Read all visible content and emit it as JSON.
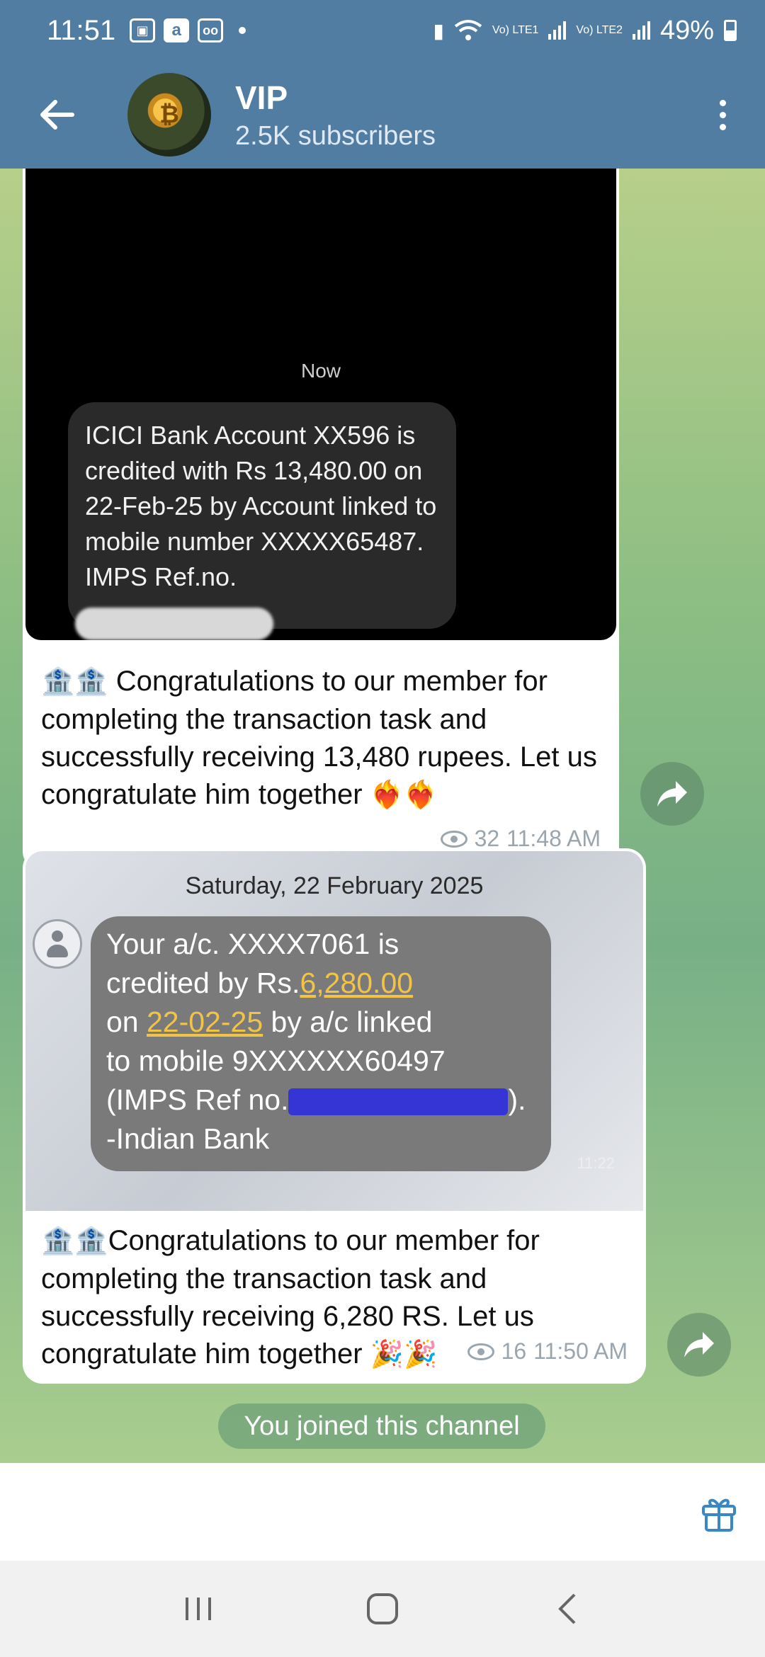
{
  "status_bar": {
    "time": "11:51",
    "battery": "49%",
    "sim1_label": "Vo) LTE1",
    "sim2_label": "Vo) LTE2"
  },
  "header": {
    "title": "VIP",
    "subtitle": "2.5K subscribers"
  },
  "messages": [
    {
      "image": {
        "timestamp_label": "Now",
        "sms_text": "ICICI Bank Account XX596 is credited with Rs 13,480.00 on 22-Feb-25 by Account linked to mobile number XXXXX65487. IMPS Ref.no."
      },
      "caption_emoji": "🏦🏦",
      "caption": " Congratulations to our member for completing the transaction task and successfully receiving 13,480 rupees. Let us congratulate him together ",
      "caption_end_emoji": "❤️‍🔥❤️‍🔥",
      "views": "32",
      "time": "11:48 AM"
    },
    {
      "image": {
        "date_label": "Saturday, 22 February 2025",
        "sms_line1": "Your a/c. XXXX7061 is",
        "sms_line2_prefix": "credited by Rs.",
        "sms_amount": "6,280.00",
        "sms_line3_prefix": "on ",
        "sms_date": "22-02-25",
        "sms_line3_suffix": " by a/c linked",
        "sms_line4": "to mobile 9XXXXXX60497",
        "sms_line5_prefix": "(IMPS Ref no.",
        "sms_line5_suffix": ").",
        "sms_line6": "-Indian Bank",
        "sms_time": "11:22"
      },
      "caption_emoji": "🏦🏦",
      "caption": "Congratulations to our member for completing the transaction task and successfully receiving 6,280 RS. Let us congratulate him together ",
      "caption_end_emoji": "🎉🎉",
      "views": "16",
      "time": "11:50 AM"
    }
  ],
  "system_message": "You joined this channel",
  "icons": {
    "back": "arrow-left-icon",
    "menu": "more-vert-icon",
    "share": "share-forward-icon",
    "gift": "gift-icon"
  },
  "colors": {
    "header_bg": "#527da3",
    "sms_highlight": "#f1c447",
    "redaction": "#3535d6"
  }
}
